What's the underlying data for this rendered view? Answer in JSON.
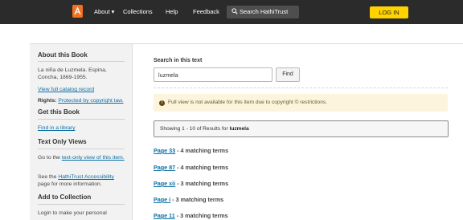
{
  "nav": {
    "about": "About ▾",
    "collections": "Collections",
    "help": "Help",
    "feedback": "Feedback",
    "search": "Search HathiTrust",
    "login": "LOG IN"
  },
  "sidebar": {
    "about_heading": "About this Book",
    "book_title": "La niña de Luzmela. Espina, Concha, 1869-1955.",
    "catalog_link": "View full catalog record",
    "rights_label": "Rights:",
    "rights_link": "Protected by copyright law.",
    "get_heading": "Get this Book",
    "find_library": "Find in a library",
    "text_only_heading": "Text Only Views",
    "text_only_pre": "Go to the ",
    "text_only_link": "text-only view of this item.",
    "see_the": "See the ",
    "accessibility_link": "HathiTrust Accessibility",
    "accessibility_post": " page for more information.",
    "add_heading": "Add to Collection",
    "login_note": "Login to make your personal"
  },
  "search": {
    "label": "Search in this text",
    "value": "luzmela",
    "find": "Find"
  },
  "alert": "Full view is not available for this item due to copyright © restrictions.",
  "results": {
    "summary": "Showing 1 - 10 of Results for ",
    "term": "luzmela",
    "items": [
      {
        "page": "Page 33",
        "terms": " - 4 matching terms"
      },
      {
        "page": "Page 87",
        "terms": " - 4 matching terms"
      },
      {
        "page": "Page xii",
        "terms": " - 3 matching terms"
      },
      {
        "page": "Page i",
        "terms": " - 3 matching terms"
      },
      {
        "page": "Page 11",
        "terms": " - 3 matching terms"
      }
    ]
  },
  "colors": {
    "navbar": "#2b2b2b",
    "logo": "#f37021",
    "login": "#ffd200",
    "link": "#0b6ea5",
    "alert_bg": "#fcf4dc"
  }
}
